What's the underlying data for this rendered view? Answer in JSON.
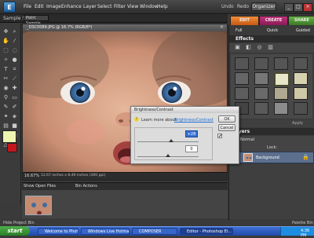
{
  "app": {
    "logo_text": "E",
    "menus": [
      "File",
      "Edit",
      "Image",
      "Enhance",
      "Layer",
      "Select",
      "Filter",
      "View",
      "Window",
      "Help"
    ],
    "undo_label": "Undo",
    "redo_label": "Redo",
    "organizer_label": "Organizer",
    "window_controls": [
      "_",
      "□",
      "×"
    ]
  },
  "options_bar": {
    "sample_label": "Sample Size:",
    "sample_value": "Point Sample"
  },
  "mode_tabs": {
    "edit": "EDIT",
    "create": "CREATE",
    "share": "SHARE"
  },
  "sub_tabs": {
    "full": "Full",
    "quick": "Quick",
    "guided": "Guided"
  },
  "document": {
    "title": "_DSC0089.JPG @ 16.7% (RGB/8*)",
    "close": "×",
    "zoom": "16.67%",
    "status": "12.67 inches x 8.49 inches (300 ppi)"
  },
  "bin": {
    "select_label": "Show Open Files",
    "actions_label": "Bin Actions",
    "hide_label": "Hide Project Bin",
    "palette_label": "Palette Bin"
  },
  "effects": {
    "title": "Effects",
    "apply_label": "Apply"
  },
  "layers": {
    "title": "Layers",
    "mode": "Normal",
    "lock_label": "Lock:",
    "layer_name": "Background"
  },
  "dialog": {
    "title": "Brightness/Contrast",
    "learn_text": "Learn more about:",
    "learn_link": "Brightness/Contrast",
    "ok_label": "OK",
    "cancel_label": "Cancel",
    "preview_label": "Preview",
    "preview_checked": "✔",
    "brightness_label": "Brightness:",
    "brightness_value": "+28",
    "contrast_label": "Contrast:",
    "contrast_value": "0"
  },
  "taskbar": {
    "start_label": "start",
    "tasks": [
      "Welcome to Photo...",
      "Windows Live Hotmail...",
      "COMPOSER",
      "Editor - Photoshop El..."
    ],
    "clock": "4:36 PM"
  },
  "colors": {
    "foreground": "#eef5b0",
    "background": "#c4161c",
    "accent_edit": "#e0772a",
    "accent_create": "#a9246b",
    "accent_share": "#4e9534"
  }
}
